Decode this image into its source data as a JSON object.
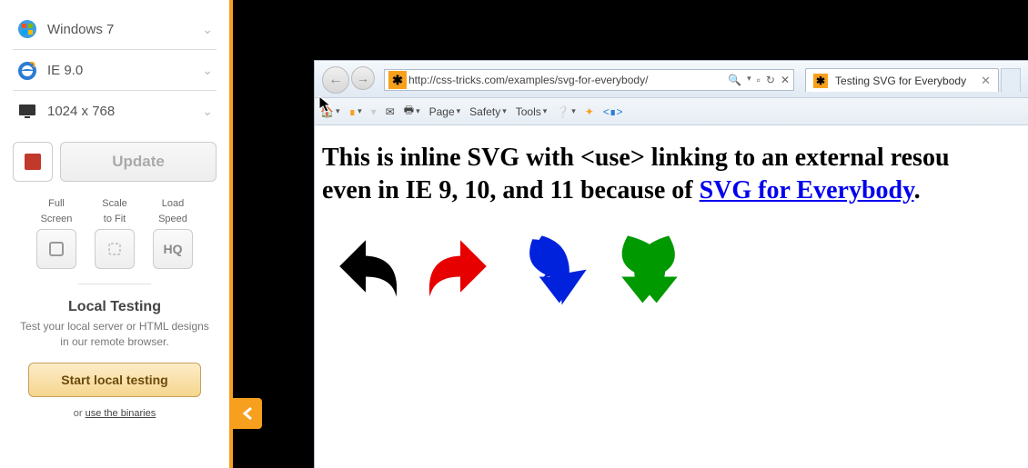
{
  "sidebar": {
    "os": {
      "label": "Windows 7"
    },
    "browser": {
      "label": "IE 9.0"
    },
    "resolution": {
      "label": "1024 x 768"
    },
    "update_label": "Update",
    "tools": {
      "fullscreen": {
        "line1": "Full",
        "line2": "Screen"
      },
      "scale": {
        "line1": "Scale",
        "line2": "to Fit"
      },
      "speed": {
        "line1": "Load",
        "line2": "Speed",
        "badge": "HQ"
      }
    },
    "local_testing": {
      "heading": "Local Testing",
      "desc": "Test your local server or HTML designs in our remote browser.",
      "button": "Start local testing",
      "or": "or ",
      "binaries_link": "use the binaries"
    }
  },
  "ie": {
    "url": "http://css-tricks.com/examples/svg-for-everybody/",
    "search_icon": "🔍",
    "tab_title": "Testing SVG for Everybody",
    "menus": {
      "page": "Page",
      "safety": "Safety",
      "tools": "Tools"
    },
    "content": {
      "line1_a": "This is inline SVG with <use> linking to an external resou",
      "line2_a": "even in IE 9, 10, and 11 because of ",
      "link_text": "SVG for Everybody",
      "line2_b": "."
    }
  }
}
